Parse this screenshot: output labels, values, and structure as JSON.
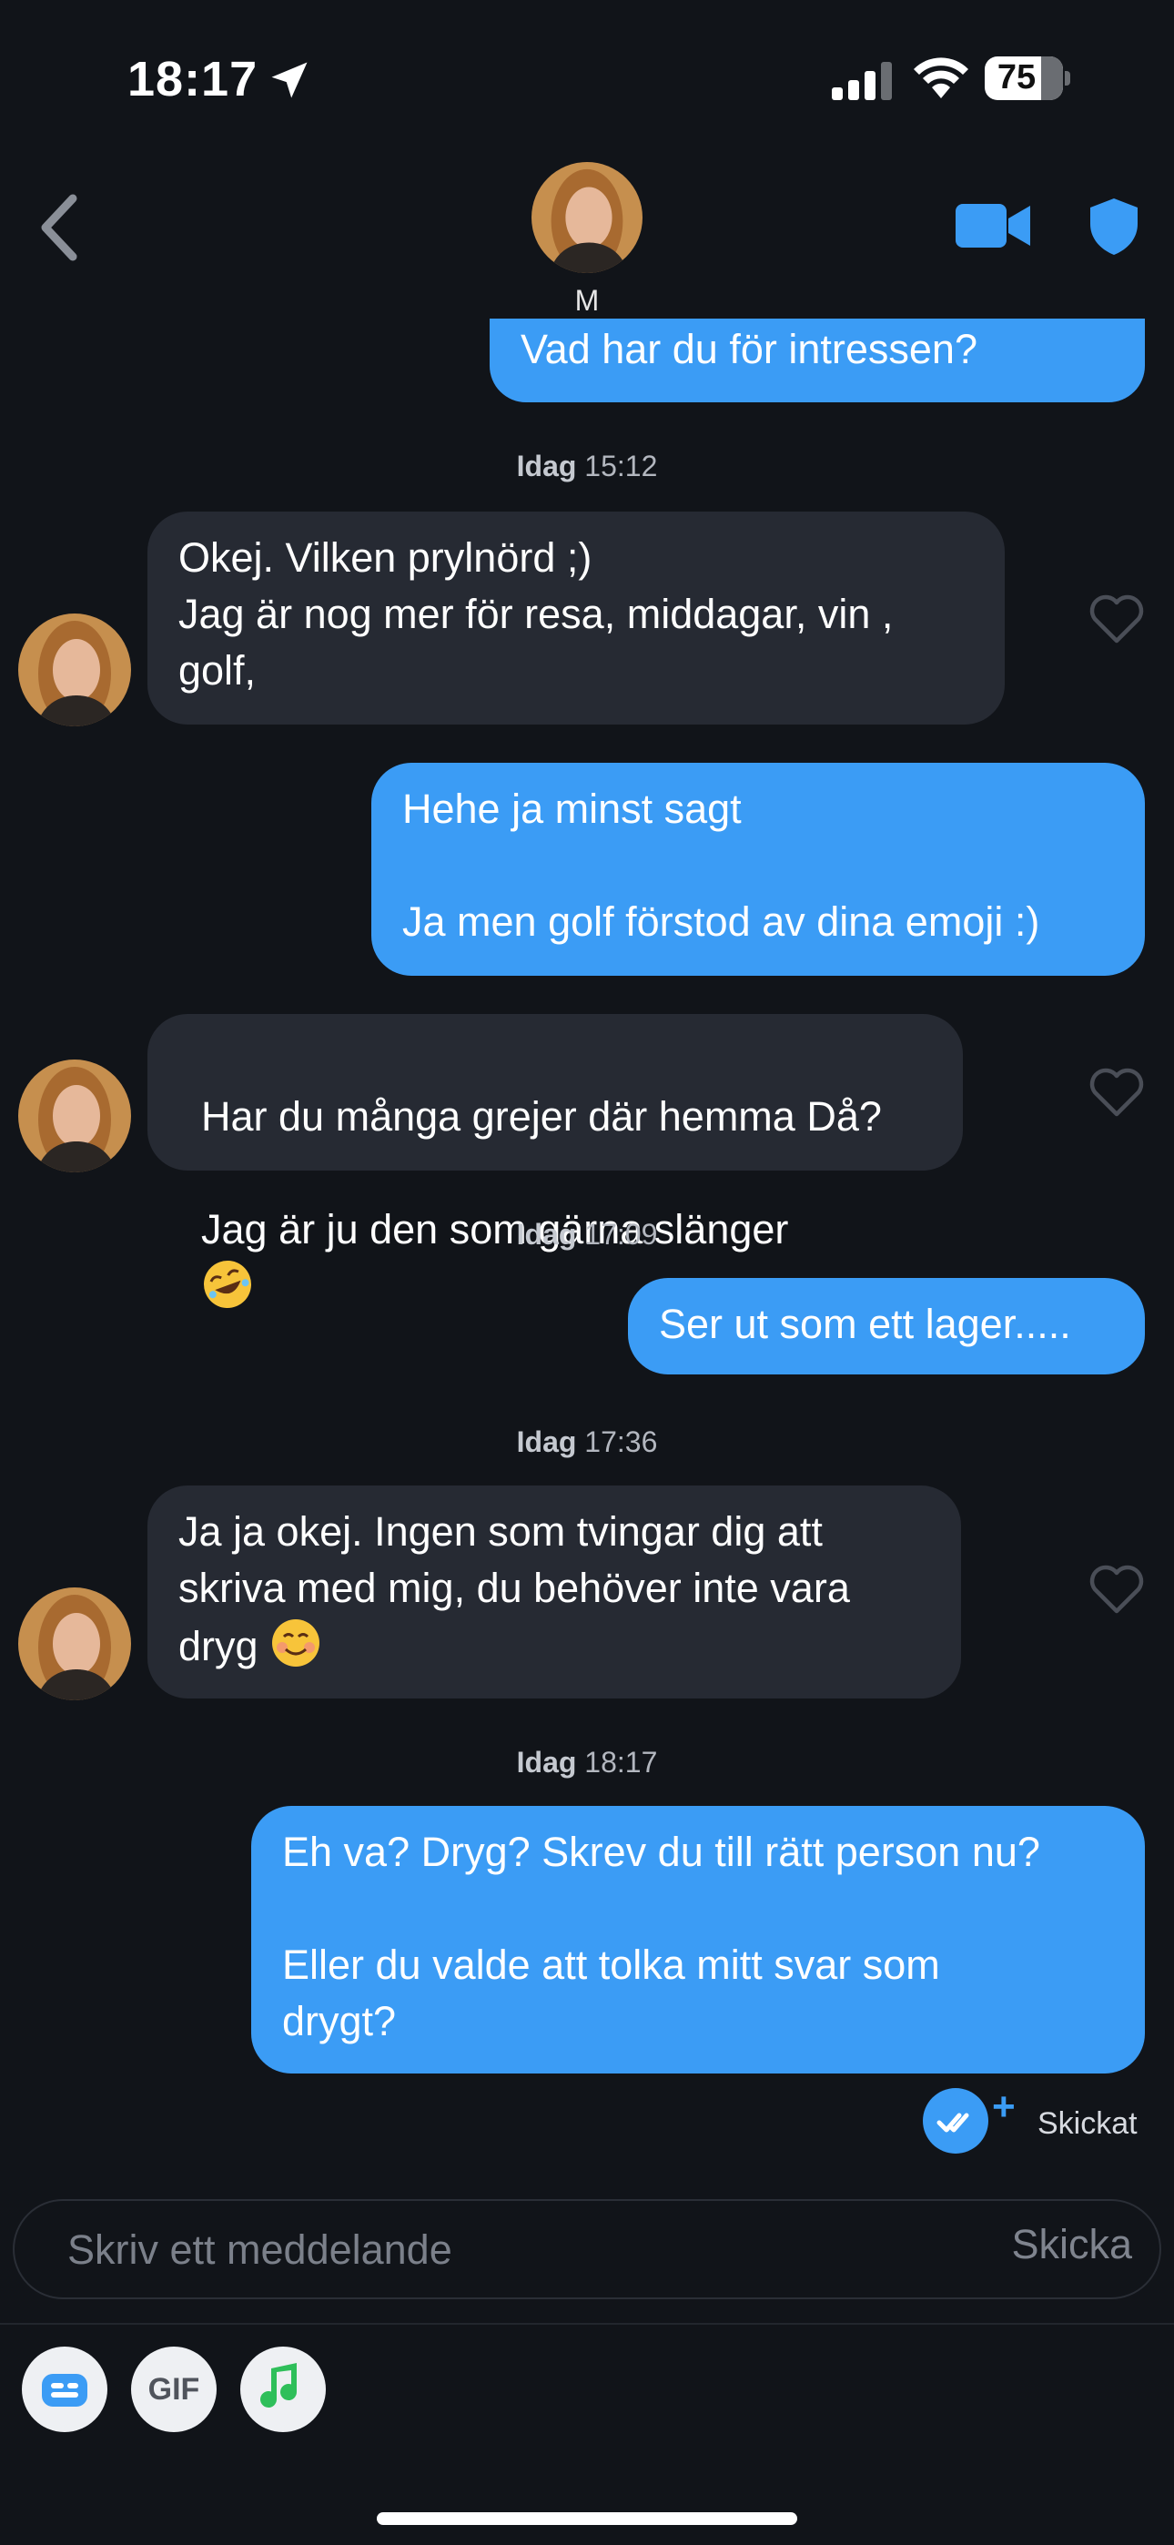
{
  "status_bar": {
    "time": "18:17",
    "battery": "75"
  },
  "header": {
    "name": "M"
  },
  "messages": {
    "m0": "Vad har du för intressen?",
    "stamp1_day": "Idag",
    "stamp1_time": "15:12",
    "m1": "Okej. Vilken prylnörd ;)\nJag är nog mer för resa, middagar, vin ,\ngolf,",
    "m2": "Hehe ja minst sagt\n\nJa men golf förstod av dina emoji :)",
    "m3_line1": "Har du många grejer där hemma Då?",
    "m3_line2": "Jag är ju den som gärna slänger",
    "stamp2_day": "Idag",
    "stamp2_time": "17:09",
    "m4": "Ser ut som ett lager.....",
    "stamp3_day": "Idag",
    "stamp3_time": "17:36",
    "m5_text": "Ja ja okej. Ingen som tvingar dig att\nskriva med mig, du behöver inte vara\ndryg",
    "stamp4_day": "Idag",
    "stamp4_time": "18:17",
    "m6": "Eh va? Dryg? Skrev du till rätt person nu?\n\nEller du valde att tolka mitt svar som\ndrygt?"
  },
  "receipt": {
    "plus": "+",
    "label": "Skickat"
  },
  "composer": {
    "placeholder": "Skriv ett meddelande",
    "send": "Skicka"
  },
  "toolbar": {
    "gif": "GIF"
  },
  "icons": [
    "location-arrow-icon",
    "signal-icon",
    "wifi-icon",
    "back-chevron-icon",
    "video-call-icon",
    "shield-icon",
    "heart-icon",
    "double-check-icon",
    "sticker-icon",
    "music-note-icon"
  ],
  "colors": {
    "background": "#111419",
    "outgoing": "#3b9cf5",
    "incoming": "#262a33",
    "music": "#2fbf5a"
  }
}
